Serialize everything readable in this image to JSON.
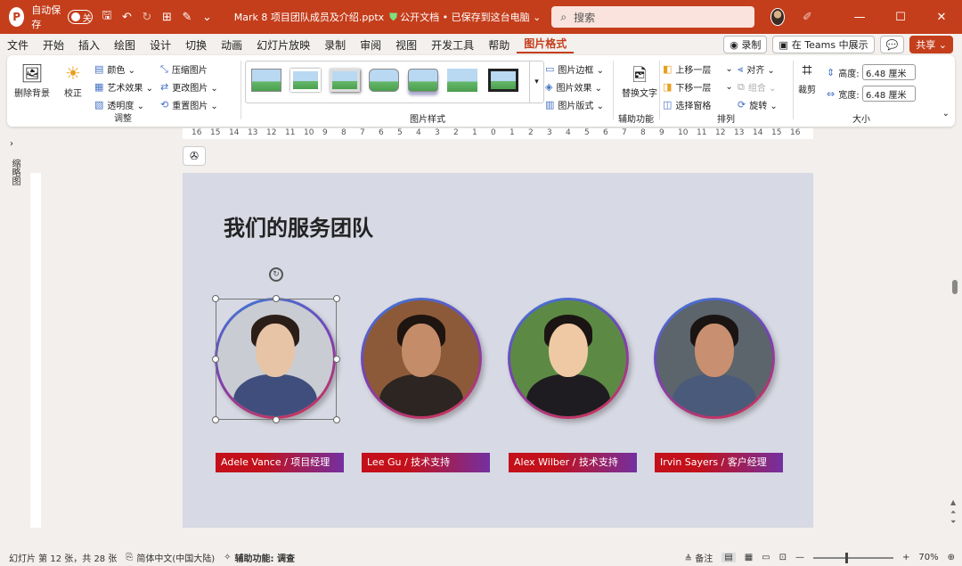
{
  "titlebar": {
    "logo": "P",
    "autosave_label": "自动保存",
    "autosave_state": "关",
    "filename": "Mark 8 项目团队成员及介绍.pptx",
    "status": "公开文档 • 已保存到这台电脑 ⌄",
    "search_placeholder": "搜索"
  },
  "menu": {
    "tabs": [
      "文件",
      "开始",
      "插入",
      "绘图",
      "设计",
      "切换",
      "动画",
      "幻灯片放映",
      "录制",
      "审阅",
      "视图",
      "开发工具",
      "帮助",
      "图片格式"
    ],
    "record_btn": "◉ 录制",
    "teams_btn": "在 Teams 中展示",
    "comment_btn": "💬",
    "share_btn": "共享 ⌄"
  },
  "ribbon": {
    "adjust": {
      "remove_bg": "删除背景",
      "correct": "校正",
      "color": "颜色 ⌄",
      "artistic": "艺术效果 ⌄",
      "transparency": "透明度 ⌄",
      "compress": "压缩图片",
      "change": "更改图片 ⌄",
      "reset": "重置图片 ⌄",
      "label": "调整"
    },
    "styles": {
      "label": "图片样式",
      "border": "图片边框 ⌄",
      "effects": "图片效果 ⌄",
      "layout": "图片版式 ⌄"
    },
    "accessibility": {
      "alt_text": "替换文字",
      "label": "辅助功能"
    },
    "arrange": {
      "bring_forward": "上移一层",
      "send_backward": "下移一层",
      "selection_pane": "选择窗格",
      "align": "对齐 ⌄",
      "group": "组合 ⌄",
      "rotate": "旋转 ⌄",
      "label": "排列"
    },
    "size": {
      "crop": "裁剪",
      "height_label": "高度:",
      "height_value": "6.48 厘米",
      "width_label": "宽度:",
      "width_value": "6.48 厘米",
      "label": "大小"
    }
  },
  "thumbpane": {
    "label": "缩略图"
  },
  "ruler": {
    "h_ticks": [
      "16",
      "15",
      "14",
      "13",
      "12",
      "11",
      "10",
      "9",
      "8",
      "7",
      "6",
      "5",
      "4",
      "3",
      "2",
      "1",
      "0",
      "1",
      "2",
      "3",
      "4",
      "5",
      "6",
      "7",
      "8",
      "9",
      "10",
      "11",
      "12",
      "13",
      "14",
      "15",
      "16"
    ]
  },
  "slide": {
    "title": "我们的服务团队",
    "members": [
      {
        "name": "Adele Vance / 项目经理",
        "skin": "#e8c4a6",
        "hair": "#2b1e18",
        "shirt": "#3f4e7c",
        "bg": "#c9ccd2"
      },
      {
        "name": "Lee Gu / 技术支持",
        "skin": "#c48c68",
        "hair": "#1e1410",
        "shirt": "#2c2522",
        "bg": "#8c5a38"
      },
      {
        "name": "Alex Wilber / 技术支持",
        "skin": "#efc9a4",
        "hair": "#1a1412",
        "shirt": "#1e1c20",
        "bg": "#5c8a44"
      },
      {
        "name": "Irvin Sayers  / 客户经理",
        "skin": "#c89070",
        "hair": "#1a1412",
        "shirt": "#4a5a7a",
        "bg": "#5c646c"
      }
    ]
  },
  "status": {
    "slide_info": "幻灯片 第 12 张，共 28 张",
    "language": "简体中文(中国大陆)",
    "accessibility": "辅助功能: 调查",
    "notes": "≜ 备注",
    "zoom": "70%"
  }
}
